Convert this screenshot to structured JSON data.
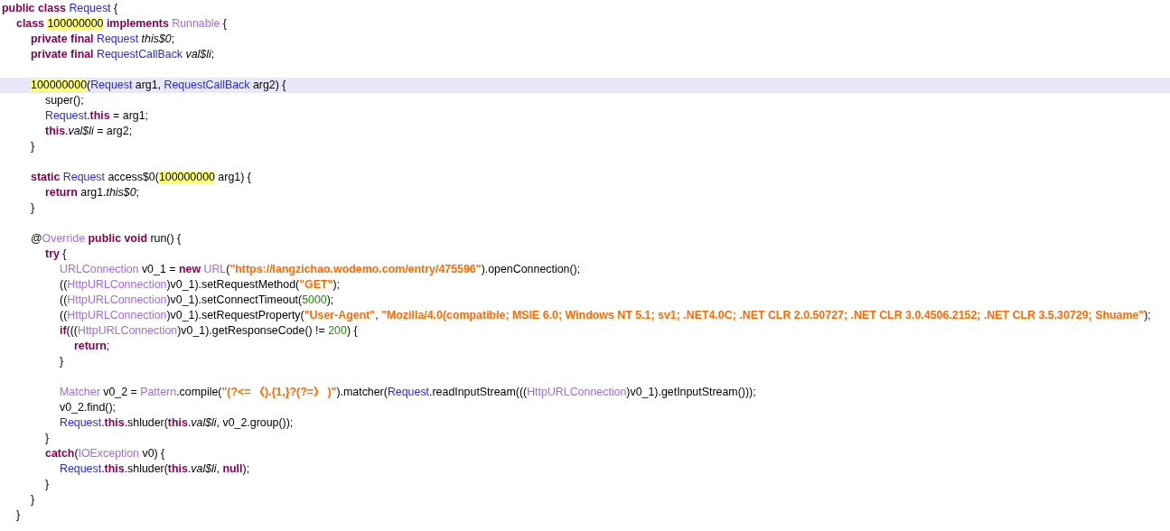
{
  "code_lines": [
    {
      "kind": "code",
      "current": false,
      "tokens": [
        {
          "kind": "keyword",
          "text": "public class "
        },
        {
          "kind": "type",
          "text": "Request"
        },
        {
          "kind": "plain",
          "text": " {"
        }
      ]
    },
    {
      "kind": "code",
      "current": false,
      "tokens": [
        {
          "kind": "keyword",
          "text": "\tclass "
        },
        {
          "kind": "highlight",
          "text": "100000000"
        },
        {
          "kind": "keyword",
          "text": " implements "
        },
        {
          "kind": "library",
          "text": "Runnable"
        },
        {
          "kind": "plain",
          "text": " {"
        }
      ]
    },
    {
      "kind": "code",
      "current": false,
      "tokens": [
        {
          "kind": "keyword",
          "text": "\t\tprivate final "
        },
        {
          "kind": "type",
          "text": "Request"
        },
        {
          "kind": "italic",
          "text": " this$0"
        },
        {
          "kind": "plain",
          "text": ";"
        }
      ]
    },
    {
      "kind": "code",
      "current": false,
      "tokens": [
        {
          "kind": "keyword",
          "text": "\t\tprivate final "
        },
        {
          "kind": "type",
          "text": "RequestCallBack"
        },
        {
          "kind": "italic",
          "text": " val$li"
        },
        {
          "kind": "plain",
          "text": ";"
        }
      ]
    },
    {
      "kind": "blank",
      "current": false
    },
    {
      "kind": "code",
      "current": true,
      "tokens": [
        {
          "kind": "highlight",
          "text": "\t\t100000000"
        },
        {
          "kind": "plain",
          "text": "("
        },
        {
          "kind": "type",
          "text": "Request"
        },
        {
          "kind": "plain",
          "text": " arg1, "
        },
        {
          "kind": "type",
          "text": "RequestCallBack"
        },
        {
          "kind": "plain",
          "text": " arg2) {"
        }
      ]
    },
    {
      "kind": "code",
      "current": false,
      "tokens": [
        {
          "kind": "plain",
          "text": "\t\t\tsuper();"
        }
      ]
    },
    {
      "kind": "code",
      "current": false,
      "tokens": [
        {
          "kind": "type",
          "text": "\t\t\tRequest"
        },
        {
          "kind": "plain",
          "text": "."
        },
        {
          "kind": "keyword",
          "text": "this"
        },
        {
          "kind": "plain",
          "text": " = arg1;"
        }
      ]
    },
    {
      "kind": "code",
      "current": false,
      "tokens": [
        {
          "kind": "keyword",
          "text": "\t\t\tthis"
        },
        {
          "kind": "plain",
          "text": "."
        },
        {
          "kind": "italic",
          "text": "val$li"
        },
        {
          "kind": "plain",
          "text": " = arg2;"
        }
      ]
    },
    {
      "kind": "code",
      "current": false,
      "tokens": [
        {
          "kind": "plain",
          "text": "\t\t}"
        }
      ]
    },
    {
      "kind": "blank",
      "current": false
    },
    {
      "kind": "code",
      "current": false,
      "tokens": [
        {
          "kind": "keyword",
          "text": "\t\tstatic "
        },
        {
          "kind": "type",
          "text": "Request"
        },
        {
          "kind": "plain",
          "text": " access$0("
        },
        {
          "kind": "highlight",
          "text": "100000000"
        },
        {
          "kind": "plain",
          "text": " arg1) {"
        }
      ]
    },
    {
      "kind": "code",
      "current": false,
      "tokens": [
        {
          "kind": "keyword",
          "text": "\t\t\treturn"
        },
        {
          "kind": "plain",
          "text": " arg1."
        },
        {
          "kind": "italic",
          "text": "this$0"
        },
        {
          "kind": "plain",
          "text": ";"
        }
      ]
    },
    {
      "kind": "code",
      "current": false,
      "tokens": [
        {
          "kind": "plain",
          "text": "\t\t}"
        }
      ]
    },
    {
      "kind": "blank",
      "current": false
    },
    {
      "kind": "code",
      "current": false,
      "tokens": [
        {
          "kind": "plain",
          "text": "\t\t@"
        },
        {
          "kind": "library",
          "text": "Override"
        },
        {
          "kind": "keyword",
          "text": " public void"
        },
        {
          "kind": "plain",
          "text": " run() {"
        }
      ]
    },
    {
      "kind": "code",
      "current": false,
      "tokens": [
        {
          "kind": "keyword",
          "text": "\t\t\ttry"
        },
        {
          "kind": "plain",
          "text": " {"
        }
      ]
    },
    {
      "kind": "code",
      "current": false,
      "tokens": [
        {
          "kind": "library",
          "text": "\t\t\t\tURLConnection"
        },
        {
          "kind": "plain",
          "text": " v0_1 = "
        },
        {
          "kind": "keyword",
          "text": "new "
        },
        {
          "kind": "library",
          "text": "URL"
        },
        {
          "kind": "plain",
          "text": "("
        },
        {
          "kind": "string",
          "text": "\"https://langzichao.wodemo.com/entry/475596\""
        },
        {
          "kind": "plain",
          "text": ").openConnection();"
        }
      ]
    },
    {
      "kind": "code",
      "current": false,
      "tokens": [
        {
          "kind": "plain",
          "text": "\t\t\t\t(("
        },
        {
          "kind": "library",
          "text": "HttpURLConnection"
        },
        {
          "kind": "plain",
          "text": ")v0_1).setRequestMethod("
        },
        {
          "kind": "string",
          "text": "\"GET\""
        },
        {
          "kind": "plain",
          "text": ");"
        }
      ]
    },
    {
      "kind": "code",
      "current": false,
      "tokens": [
        {
          "kind": "plain",
          "text": "\t\t\t\t(("
        },
        {
          "kind": "library",
          "text": "HttpURLConnection"
        },
        {
          "kind": "plain",
          "text": ")v0_1).setConnectTimeout("
        },
        {
          "kind": "number",
          "text": "5000"
        },
        {
          "kind": "plain",
          "text": ");"
        }
      ]
    },
    {
      "kind": "code",
      "current": false,
      "tokens": [
        {
          "kind": "plain",
          "text": "\t\t\t\t(("
        },
        {
          "kind": "library",
          "text": "HttpURLConnection"
        },
        {
          "kind": "plain",
          "text": ")v0_1).setRequestProperty("
        },
        {
          "kind": "string",
          "text": "\"User-Agent\""
        },
        {
          "kind": "plain",
          "text": ", "
        },
        {
          "kind": "string",
          "text": "\"Mozilla/4.0(compatible; MSIE 6.0; Windows NT 5.1; sv1; .NET4.0C; .NET CLR 2.0.50727; .NET CLR 3.0.4506.2152; .NET CLR 3.5.30729; Shuame\""
        },
        {
          "kind": "plain",
          "text": ");"
        }
      ]
    },
    {
      "kind": "code",
      "current": false,
      "tokens": [
        {
          "kind": "keyword",
          "text": "\t\t\t\tif"
        },
        {
          "kind": "plain",
          "text": "((("
        },
        {
          "kind": "library",
          "text": "HttpURLConnection"
        },
        {
          "kind": "plain",
          "text": ")v0_1).getResponseCode() != "
        },
        {
          "kind": "number",
          "text": "200"
        },
        {
          "kind": "plain",
          "text": ") {"
        }
      ]
    },
    {
      "kind": "code",
      "current": false,
      "tokens": [
        {
          "kind": "keyword",
          "text": "\t\t\t\t\treturn"
        },
        {
          "kind": "plain",
          "text": ";"
        }
      ]
    },
    {
      "kind": "code",
      "current": false,
      "tokens": [
        {
          "kind": "plain",
          "text": "\t\t\t\t}"
        }
      ]
    },
    {
      "kind": "blank",
      "current": false
    },
    {
      "kind": "code",
      "current": false,
      "tokens": [
        {
          "kind": "library",
          "text": "\t\t\t\tMatcher"
        },
        {
          "kind": "plain",
          "text": " v0_2 = "
        },
        {
          "kind": "library",
          "text": "Pattern"
        },
        {
          "kind": "plain",
          "text": ".compile("
        },
        {
          "kind": "string",
          "text": "\"(?<= 《).{1,}?(?=》 )\""
        },
        {
          "kind": "plain",
          "text": ").matcher("
        },
        {
          "kind": "type",
          "text": "Request"
        },
        {
          "kind": "plain",
          "text": ".readInputStream((("
        },
        {
          "kind": "library",
          "text": "HttpURLConnection"
        },
        {
          "kind": "plain",
          "text": ")v0_1).getInputStream()));"
        }
      ]
    },
    {
      "kind": "code",
      "current": false,
      "tokens": [
        {
          "kind": "plain",
          "text": "\t\t\t\tv0_2.find();"
        }
      ]
    },
    {
      "kind": "code",
      "current": false,
      "tokens": [
        {
          "kind": "type",
          "text": "\t\t\t\tRequest"
        },
        {
          "kind": "plain",
          "text": "."
        },
        {
          "kind": "keyword",
          "text": "this"
        },
        {
          "kind": "plain",
          "text": ".shluder("
        },
        {
          "kind": "keyword",
          "text": "this"
        },
        {
          "kind": "plain",
          "text": "."
        },
        {
          "kind": "italic",
          "text": "val$li"
        },
        {
          "kind": "plain",
          "text": ", v0_2.group());"
        }
      ]
    },
    {
      "kind": "code",
      "current": false,
      "tokens": [
        {
          "kind": "plain",
          "text": "\t\t\t}"
        }
      ]
    },
    {
      "kind": "code",
      "current": false,
      "tokens": [
        {
          "kind": "keyword",
          "text": "\t\t\tcatch"
        },
        {
          "kind": "plain",
          "text": "("
        },
        {
          "kind": "library",
          "text": "IOException"
        },
        {
          "kind": "plain",
          "text": " v0) {"
        }
      ]
    },
    {
      "kind": "code",
      "current": false,
      "tokens": [
        {
          "kind": "type",
          "text": "\t\t\t\tRequest"
        },
        {
          "kind": "plain",
          "text": "."
        },
        {
          "kind": "keyword",
          "text": "this"
        },
        {
          "kind": "plain",
          "text": ".shluder("
        },
        {
          "kind": "keyword",
          "text": "this"
        },
        {
          "kind": "plain",
          "text": "."
        },
        {
          "kind": "italic",
          "text": "val$li"
        },
        {
          "kind": "plain",
          "text": ", "
        },
        {
          "kind": "keyword",
          "text": "null"
        },
        {
          "kind": "plain",
          "text": ");"
        }
      ]
    },
    {
      "kind": "code",
      "current": false,
      "tokens": [
        {
          "kind": "plain",
          "text": "\t\t\t}"
        }
      ]
    },
    {
      "kind": "code",
      "current": false,
      "tokens": [
        {
          "kind": "plain",
          "text": "\t\t}"
        }
      ]
    },
    {
      "kind": "code",
      "current": false,
      "tokens": [
        {
          "kind": "plain",
          "text": "\t}"
        }
      ]
    }
  ]
}
